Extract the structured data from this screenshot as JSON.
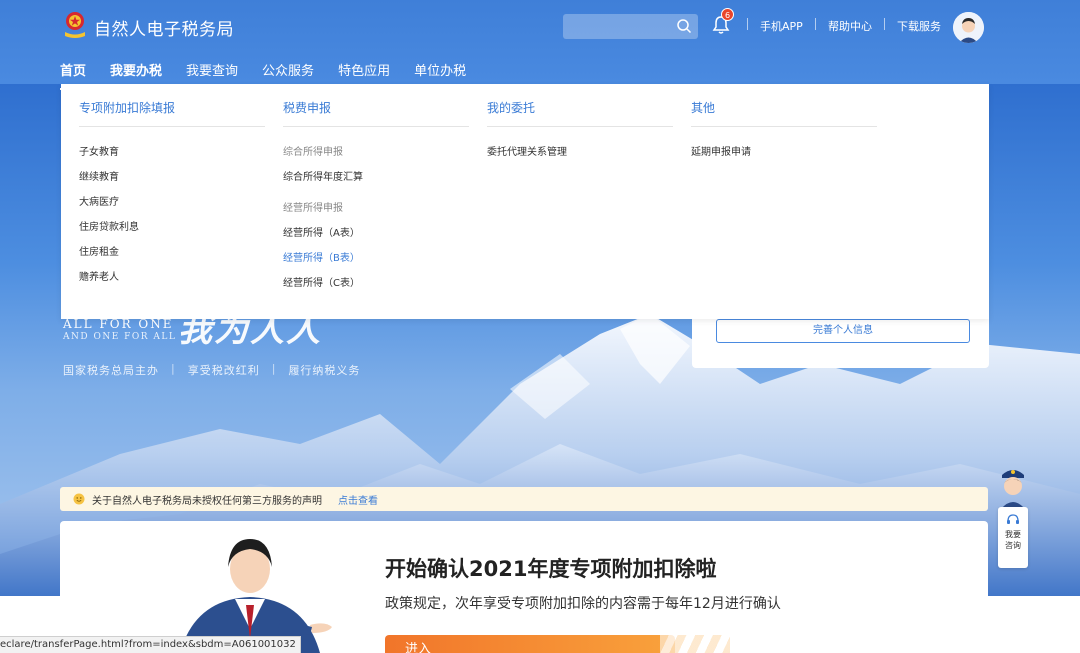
{
  "header": {
    "site_title": "自然人电子税务局",
    "search": {
      "placeholder": ""
    },
    "notification_count": "6",
    "links": [
      "手机APP",
      "帮助中心",
      "下载服务"
    ]
  },
  "nav": {
    "items": [
      {
        "label": "首页"
      },
      {
        "label": "我要办税"
      },
      {
        "label": "我要查询"
      },
      {
        "label": "公众服务"
      },
      {
        "label": "特色应用"
      },
      {
        "label": "单位办税"
      }
    ]
  },
  "dropdown": {
    "columns": [
      {
        "heading": "专项附加扣除填报",
        "items": [
          "子女教育",
          "继续教育",
          "大病医疗",
          "住房贷款利息",
          "住房租金",
          "赡养老人"
        ]
      },
      {
        "heading": "税费申报",
        "group1": "综合所得申报",
        "group1_items": [
          "综合所得年度汇算"
        ],
        "group2": "经营所得申报",
        "group2_items": [
          "经营所得（A表）",
          "经营所得（B表）",
          "经营所得（C表）"
        ]
      },
      {
        "heading": "我的委托",
        "items": [
          "委托代理关系管理"
        ]
      },
      {
        "heading": "其他",
        "items": [
          "延期申报申请"
        ]
      }
    ]
  },
  "banner": {
    "slogan_en_1": "ALL FOR ONE",
    "slogan_en_2": "AND ONE FOR ALL",
    "slogan_zh": "我为人人",
    "tagline": [
      "国家税务总局主办",
      "享受税改红利",
      "履行纳税义务"
    ],
    "complete_info_button": "完善个人信息"
  },
  "notice": {
    "text": "关于自然人电子税务局未授权任何第三方服务的声明",
    "link": "点击查看"
  },
  "help_widget": {
    "label_1": "我要",
    "label_2": "咨询"
  },
  "promo": {
    "title": "开始确认2021年度专项附加扣除啦",
    "subtitle": "政策规定，次年享受专项附加扣除的内容需于每年12月进行确认",
    "button": "进入"
  },
  "status_bar": {
    "url": "eclare/transferPage.html?from=index&sbdm=A061001032"
  },
  "colors": {
    "header_blue": "#4a8ae0",
    "link_blue": "#3a7bd5",
    "badge_red": "#e8452b",
    "promo_orange": "#f1752a",
    "notice_bg": "#fdf6e3"
  }
}
